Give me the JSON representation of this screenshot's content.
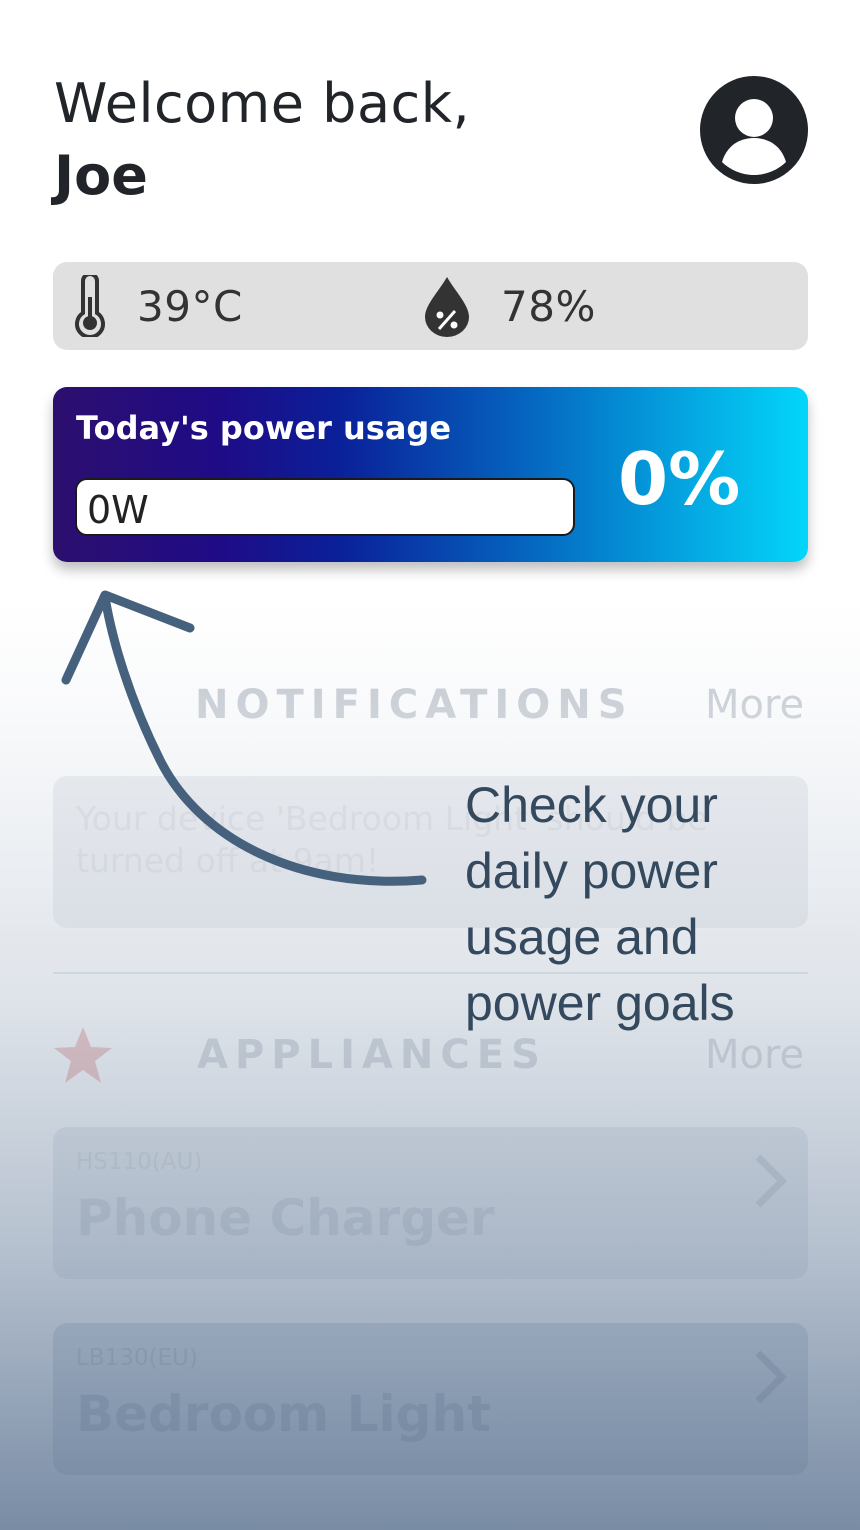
{
  "header": {
    "greeting": "Welcome back,",
    "username": "Joe",
    "avatar_icon": "user-circle-icon"
  },
  "weather": {
    "temperature": "39°C",
    "temperature_icon": "thermometer-icon",
    "humidity": "78%",
    "humidity_icon": "humidity-drop-icon"
  },
  "power_usage": {
    "title": "Today's power usage",
    "watts": "0W",
    "percent": "0%",
    "progress_fraction": 0
  },
  "notifications": {
    "header": "NOTIFICATIONS",
    "more_label": "More",
    "items": [
      {
        "message": "Your device 'Bedroom Light' should be turned off at 9am!"
      }
    ]
  },
  "appliances": {
    "header": "APPLIANCES",
    "more_label": "More",
    "favorite_icon": "star-icon",
    "items": [
      {
        "model": "HS110(AU)",
        "name": "Phone Charger"
      },
      {
        "model": "LB130(EU)",
        "name": "Bedroom Light"
      }
    ]
  },
  "coach_mark": {
    "text": "Check your daily power usage and power goals",
    "lines": [
      "Check your",
      "daily power",
      "usage and",
      "power goals"
    ]
  },
  "colors": {
    "gradient_start": "#2c0f6e",
    "gradient_end": "#03d6fa",
    "coach_text": "#34495e",
    "star": "#e08a8a"
  }
}
